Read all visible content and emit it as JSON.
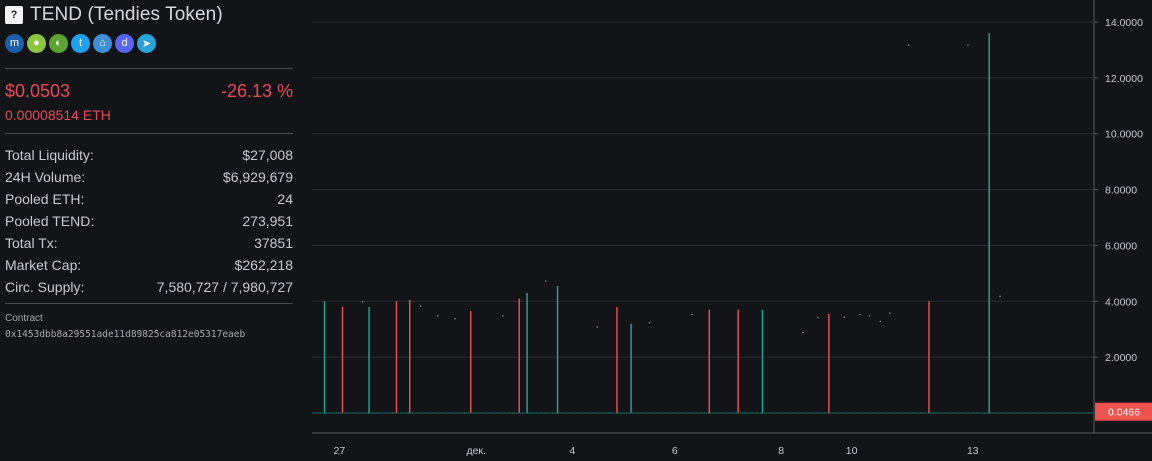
{
  "token": {
    "logo_glyph": "?",
    "name": "TEND (Tendies Token)"
  },
  "social_icons": [
    {
      "name": "coinmarketcap-icon",
      "color": "#1b5ea9",
      "glyph": "m"
    },
    {
      "name": "coingecko-icon",
      "color": "#8dc63f",
      "glyph": "●"
    },
    {
      "name": "coingecko-alt-icon",
      "color": "#5da52f",
      "glyph": "◐"
    },
    {
      "name": "twitter-icon",
      "color": "#1da1f2",
      "glyph": "t"
    },
    {
      "name": "website-icon",
      "color": "#3f8fd8",
      "glyph": "⌂"
    },
    {
      "name": "discord-icon",
      "color": "#5865f2",
      "glyph": "d"
    },
    {
      "name": "telegram-icon",
      "color": "#2aa3dc",
      "glyph": "➤"
    }
  ],
  "price": {
    "usd": "$0.0503",
    "change": "-26.13 %",
    "eth": "0.00008514 ETH"
  },
  "stats": [
    {
      "label": "Total Liquidity:",
      "value": "$27,008"
    },
    {
      "label": "24H Volume:",
      "value": "$6,929,679"
    },
    {
      "label": "Pooled ETH:",
      "value": "24"
    },
    {
      "label": "Pooled TEND:",
      "value": "273,951"
    },
    {
      "label": "Total Tx:",
      "value": "37851"
    },
    {
      "label": "Market Cap:",
      "value": "$262,218"
    },
    {
      "label": "Circ. Supply:",
      "value": "7,580,727 / 7,980,727"
    }
  ],
  "contract": {
    "label": "Contract",
    "address": "0x1453dbb8a29551ade11d89825ca812e05317eaeb"
  },
  "colors": {
    "up": "#26a69a",
    "down": "#ef5350",
    "grid": "#2a2c31",
    "price_tag": "#ef5350"
  },
  "chart_data": {
    "type": "bar",
    "title": "",
    "ylim": [
      0,
      14
    ],
    "y_ticks": [
      "2.0000",
      "4.0000",
      "6.0000",
      "8.0000",
      "10.0000",
      "12.0000",
      "14.0000"
    ],
    "y_tick_values": [
      2,
      4,
      6,
      8,
      10,
      12,
      14
    ],
    "current_price_label": "0.0466",
    "current_price_value": 0.0466,
    "x_ticks": [
      {
        "label": "27",
        "t": 0.035
      },
      {
        "label": "дек.",
        "t": 0.21
      },
      {
        "label": "4",
        "t": 0.333
      },
      {
        "label": "6",
        "t": 0.464
      },
      {
        "label": "8",
        "t": 0.6
      },
      {
        "label": "10",
        "t": 0.69
      },
      {
        "label": "13",
        "t": 0.845
      }
    ],
    "wicks": [
      {
        "t": 0.016,
        "high": 4.0,
        "dir": "up"
      },
      {
        "t": 0.039,
        "high": 3.8,
        "dir": "down"
      },
      {
        "t": 0.073,
        "high": 3.8,
        "dir": "up"
      },
      {
        "t": 0.108,
        "high": 4.0,
        "dir": "down"
      },
      {
        "t": 0.125,
        "high": 4.05,
        "dir": "down"
      },
      {
        "t": 0.203,
        "high": 3.65,
        "dir": "down"
      },
      {
        "t": 0.265,
        "high": 4.1,
        "dir": "down"
      },
      {
        "t": 0.275,
        "high": 4.3,
        "dir": "up"
      },
      {
        "t": 0.314,
        "high": 4.55,
        "dir": "up"
      },
      {
        "t": 0.39,
        "high": 3.8,
        "dir": "down"
      },
      {
        "t": 0.408,
        "high": 3.2,
        "dir": "up"
      },
      {
        "t": 0.508,
        "high": 3.7,
        "dir": "down"
      },
      {
        "t": 0.545,
        "high": 3.7,
        "dir": "down"
      },
      {
        "t": 0.576,
        "high": 3.7,
        "dir": "up"
      },
      {
        "t": 0.661,
        "high": 3.55,
        "dir": "down"
      },
      {
        "t": 0.789,
        "high": 4.0,
        "dir": "down"
      },
      {
        "t": 0.866,
        "high": 13.6,
        "dir": "up"
      }
    ],
    "dots": [
      {
        "t": 0.064,
        "v": 4.0
      },
      {
        "t": 0.138,
        "v": 3.85
      },
      {
        "t": 0.16,
        "v": 3.5
      },
      {
        "t": 0.182,
        "v": 3.4
      },
      {
        "t": 0.243,
        "v": 3.5
      },
      {
        "t": 0.298,
        "v": 4.75
      },
      {
        "t": 0.364,
        "v": 3.1
      },
      {
        "t": 0.431,
        "v": 3.25
      },
      {
        "t": 0.485,
        "v": 3.55
      },
      {
        "t": 0.627,
        "v": 2.9
      },
      {
        "t": 0.646,
        "v": 3.45
      },
      {
        "t": 0.68,
        "v": 3.45
      },
      {
        "t": 0.7,
        "v": 3.55
      },
      {
        "t": 0.712,
        "v": 3.5
      },
      {
        "t": 0.726,
        "v": 3.3
      },
      {
        "t": 0.738,
        "v": 3.6
      },
      {
        "t": 0.762,
        "v": 13.2
      },
      {
        "t": 0.838,
        "v": 13.2
      },
      {
        "t": 0.879,
        "v": 4.2
      }
    ]
  }
}
